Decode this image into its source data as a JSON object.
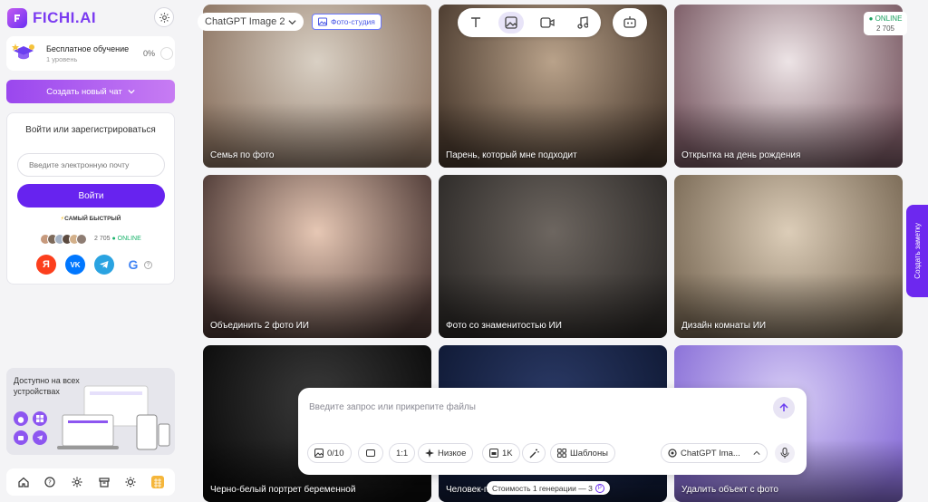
{
  "sidebar": {
    "logo": "FICHI.AI",
    "education": {
      "title": "Бесплатное обучение",
      "level": "1 уровень",
      "percent": "0%"
    },
    "new_chat_label": "Создать новый чат",
    "login": {
      "title": "Войти или зарегистрироваться",
      "email_placeholder": "Введите электронную почту",
      "button_label": "Войти",
      "fastest_label": "САМЫЙ БЫСТРЫЙ",
      "online_count": "2 705",
      "online_label": "ONLINE",
      "socials": [
        "Я",
        "VK",
        "Telegram",
        "G"
      ]
    },
    "devices": {
      "text": "Доступно на всех устройствах"
    }
  },
  "main": {
    "model_selector": "ChatGPT Image 2",
    "studio_label": "Фото-студия",
    "online_badge": {
      "label": "ONLINE",
      "count": "2 705"
    },
    "side_tab_label": "Создать заметку",
    "cards": [
      {
        "label": "Семья по фото",
        "colors": [
          "#d9d0c4",
          "#8c7462"
        ]
      },
      {
        "label": "Парень, который мне подходит",
        "colors": [
          "#b9a28a",
          "#4a3a2e"
        ]
      },
      {
        "label": "Открытка на день рождения",
        "colors": [
          "#ede4e6",
          "#7a5a64"
        ]
      },
      {
        "label": "Объединить 2 фото ИИ",
        "colors": [
          "#e6c7b4",
          "#4e3a36"
        ]
      },
      {
        "label": "Фото со знаменитостью ИИ",
        "colors": [
          "#6d6660",
          "#2d2a28"
        ]
      },
      {
        "label": "Дизайн комнаты ИИ",
        "colors": [
          "#dccdb8",
          "#7a6a56"
        ]
      },
      {
        "label": "Черно-белый портрет беременной",
        "colors": [
          "#3a3a3a",
          "#0c0c0c"
        ]
      },
      {
        "label": "Человек-паук ИИ",
        "colors": [
          "#2b3a66",
          "#101a36"
        ]
      },
      {
        "label": "Удалить объект с фото",
        "colors": [
          "#d7cdf5",
          "#8a70d8"
        ]
      }
    ],
    "composer": {
      "placeholder": "Введите запрос или прикрепите файлы",
      "chips": {
        "images": "0/10",
        "ratio": "1:1",
        "quality": "Низкое",
        "resolution": "1K",
        "templates": "Шаблоны",
        "model": "ChatGPT Ima..."
      },
      "cost_label": "Стоимость 1 генерации — 3"
    }
  }
}
